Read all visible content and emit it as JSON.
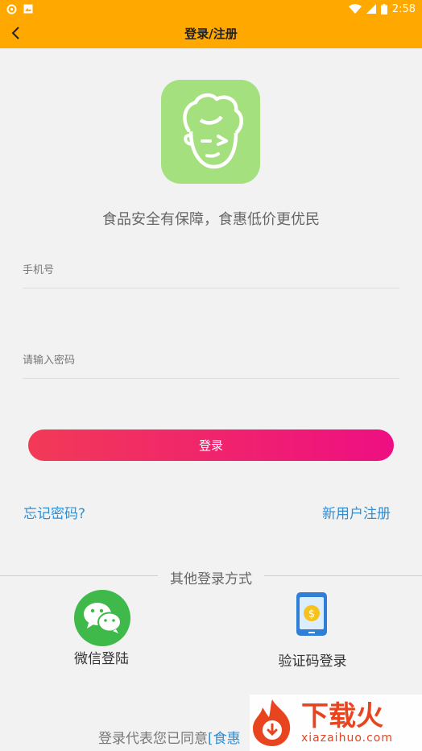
{
  "status_bar": {
    "time": "2:58"
  },
  "header": {
    "title": "登录/注册"
  },
  "slogan": "食品安全有保障，食惠低价更优民",
  "form": {
    "phone_placeholder": "手机号",
    "password_placeholder": "请输入密码",
    "login_label": "登录"
  },
  "links": {
    "forgot": "忘记密码?",
    "register": "新用户注册"
  },
  "other_login": {
    "title": "其他登录方式",
    "wechat_label": "微信登陆",
    "code_label": "验证码登录"
  },
  "agreement": {
    "prefix": "登录代表您已同意",
    "link": "[食惠"
  },
  "watermark": {
    "cn": "下载火",
    "en": "xiazaihuo.com"
  },
  "colors": {
    "accent": "#ffa800",
    "link": "#2f8fd6",
    "wechat": "#3fb949",
    "logo_bg": "#a5e07f"
  }
}
